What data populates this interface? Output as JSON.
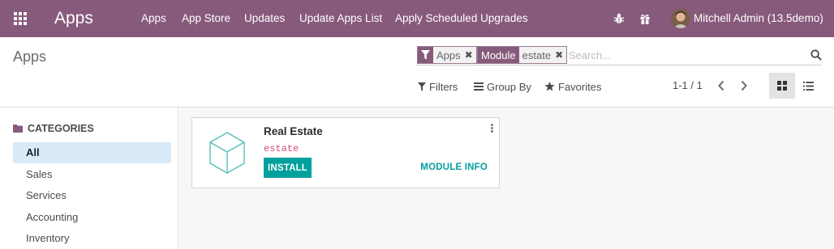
{
  "navbar": {
    "brand": "Apps",
    "menu": [
      {
        "label": "Apps"
      },
      {
        "label": "App Store"
      },
      {
        "label": "Updates"
      },
      {
        "label": "Update Apps List"
      },
      {
        "label": "Apply Scheduled Upgrades"
      }
    ],
    "icons": [
      "bug-icon",
      "gift-icon"
    ],
    "user": "Mitchell Admin (13.5demo)",
    "color": "#875a7b"
  },
  "control_panel": {
    "title": "Apps",
    "search": {
      "facets": [
        {
          "label": "Apps",
          "icon": "filter-icon",
          "value": ""
        },
        {
          "label": "Module",
          "value": "estate"
        }
      ],
      "placeholder": "Search..."
    },
    "buttons": {
      "filters": "Filters",
      "group_by": "Group By",
      "favorites": "Favorites"
    },
    "pager": "1-1 / 1",
    "views": [
      "kanban-view-icon",
      "list-view-icon"
    ]
  },
  "sidebar": {
    "header": "CATEGORIES",
    "items": [
      {
        "label": "All",
        "active": true
      },
      {
        "label": "Sales"
      },
      {
        "label": "Services"
      },
      {
        "label": "Accounting"
      },
      {
        "label": "Inventory"
      }
    ]
  },
  "cards": [
    {
      "title": "Real Estate",
      "technical_name": "estate",
      "install_label": "INSTALL",
      "info_label": "MODULE INFO",
      "icon": "cube-icon"
    }
  ],
  "colors": {
    "accent": "#00a09d",
    "tech_name": "#d64c7e",
    "active_category": "#d9ebf8"
  }
}
